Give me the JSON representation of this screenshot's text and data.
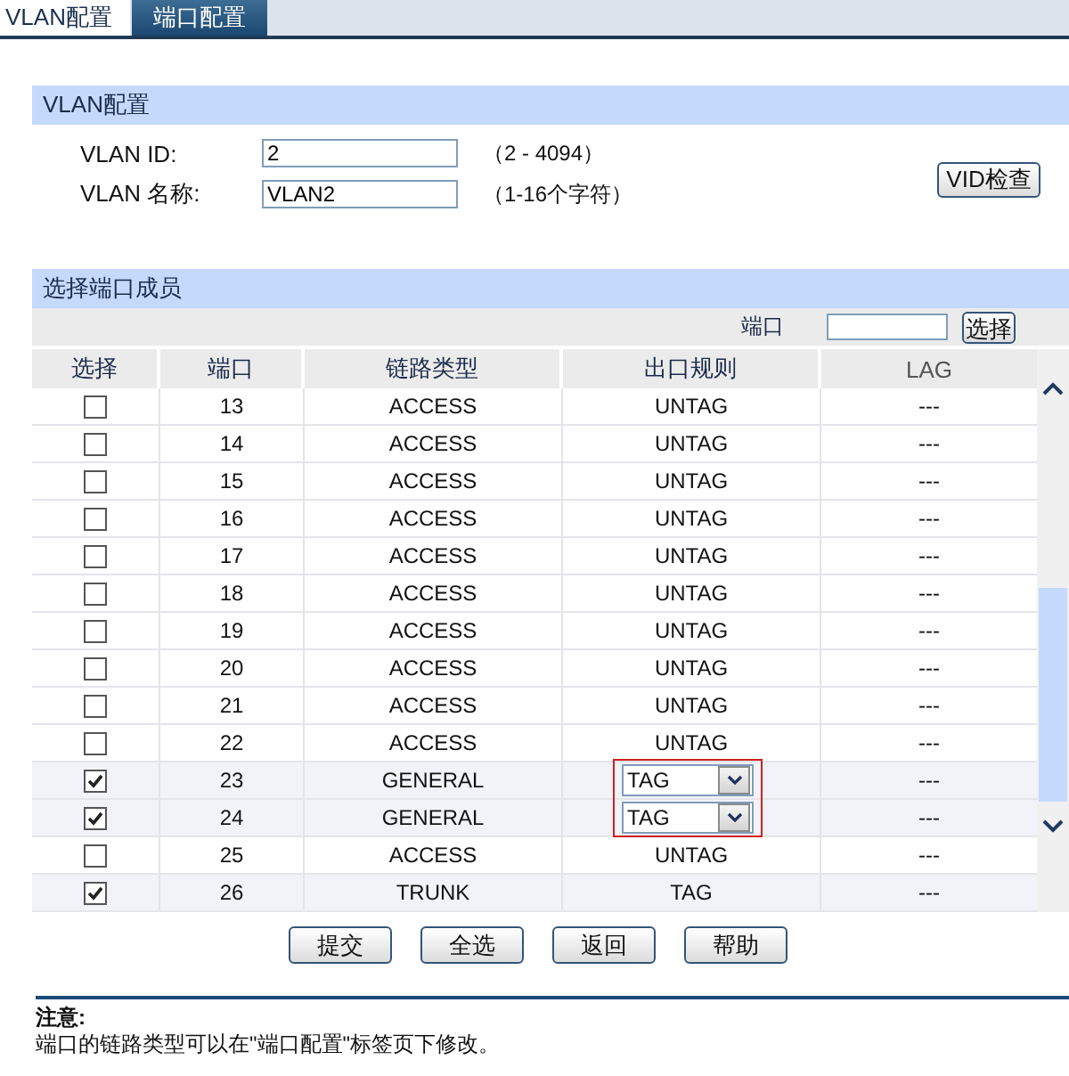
{
  "tabs": [
    {
      "label": "VLAN配置",
      "selected": true
    },
    {
      "label": "端口配置",
      "selected": false
    }
  ],
  "vlan_section": {
    "title": "VLAN配置",
    "fields": [
      {
        "label": "VLAN ID:",
        "value": "2",
        "hint": "（2 - 4094）"
      },
      {
        "label": "VLAN 名称:",
        "value": "VLAN2",
        "hint": "（1-16个字符）"
      }
    ],
    "check_button": "VID检查"
  },
  "ports_section": {
    "title": "选择端口成员",
    "port_label": "端口",
    "select_button": "选择",
    "columns": [
      "选择",
      "端口",
      "链路类型",
      "出口规则",
      "LAG"
    ],
    "rows": [
      {
        "checked": false,
        "port": "13",
        "link_type": "ACCESS",
        "egress": "UNTAG",
        "kind": "text",
        "lag": "---"
      },
      {
        "checked": false,
        "port": "14",
        "link_type": "ACCESS",
        "egress": "UNTAG",
        "kind": "text",
        "lag": "---"
      },
      {
        "checked": false,
        "port": "15",
        "link_type": "ACCESS",
        "egress": "UNTAG",
        "kind": "text",
        "lag": "---"
      },
      {
        "checked": false,
        "port": "16",
        "link_type": "ACCESS",
        "egress": "UNTAG",
        "kind": "text",
        "lag": "---"
      },
      {
        "checked": false,
        "port": "17",
        "link_type": "ACCESS",
        "egress": "UNTAG",
        "kind": "text",
        "lag": "---"
      },
      {
        "checked": false,
        "port": "18",
        "link_type": "ACCESS",
        "egress": "UNTAG",
        "kind": "text",
        "lag": "---"
      },
      {
        "checked": false,
        "port": "19",
        "link_type": "ACCESS",
        "egress": "UNTAG",
        "kind": "text",
        "lag": "---"
      },
      {
        "checked": false,
        "port": "20",
        "link_type": "ACCESS",
        "egress": "UNTAG",
        "kind": "text",
        "lag": "---"
      },
      {
        "checked": false,
        "port": "21",
        "link_type": "ACCESS",
        "egress": "UNTAG",
        "kind": "text",
        "lag": "---"
      },
      {
        "checked": false,
        "port": "22",
        "link_type": "ACCESS",
        "egress": "UNTAG",
        "kind": "text",
        "lag": "---"
      },
      {
        "checked": true,
        "port": "23",
        "link_type": "GENERAL",
        "egress": "TAG",
        "kind": "select",
        "lag": "---"
      },
      {
        "checked": true,
        "port": "24",
        "link_type": "GENERAL",
        "egress": "TAG",
        "kind": "select",
        "lag": "---"
      },
      {
        "checked": false,
        "port": "25",
        "link_type": "ACCESS",
        "egress": "UNTAG",
        "kind": "text",
        "lag": "---"
      },
      {
        "checked": true,
        "port": "26",
        "link_type": "TRUNK",
        "egress": "TAG",
        "kind": "text",
        "lag": "---"
      }
    ]
  },
  "buttons": [
    "提交",
    "全选",
    "返回",
    "帮助"
  ],
  "note": {
    "title": "注意:",
    "text": "端口的链路类型可以在\"端口配置\"标签页下修改。"
  }
}
